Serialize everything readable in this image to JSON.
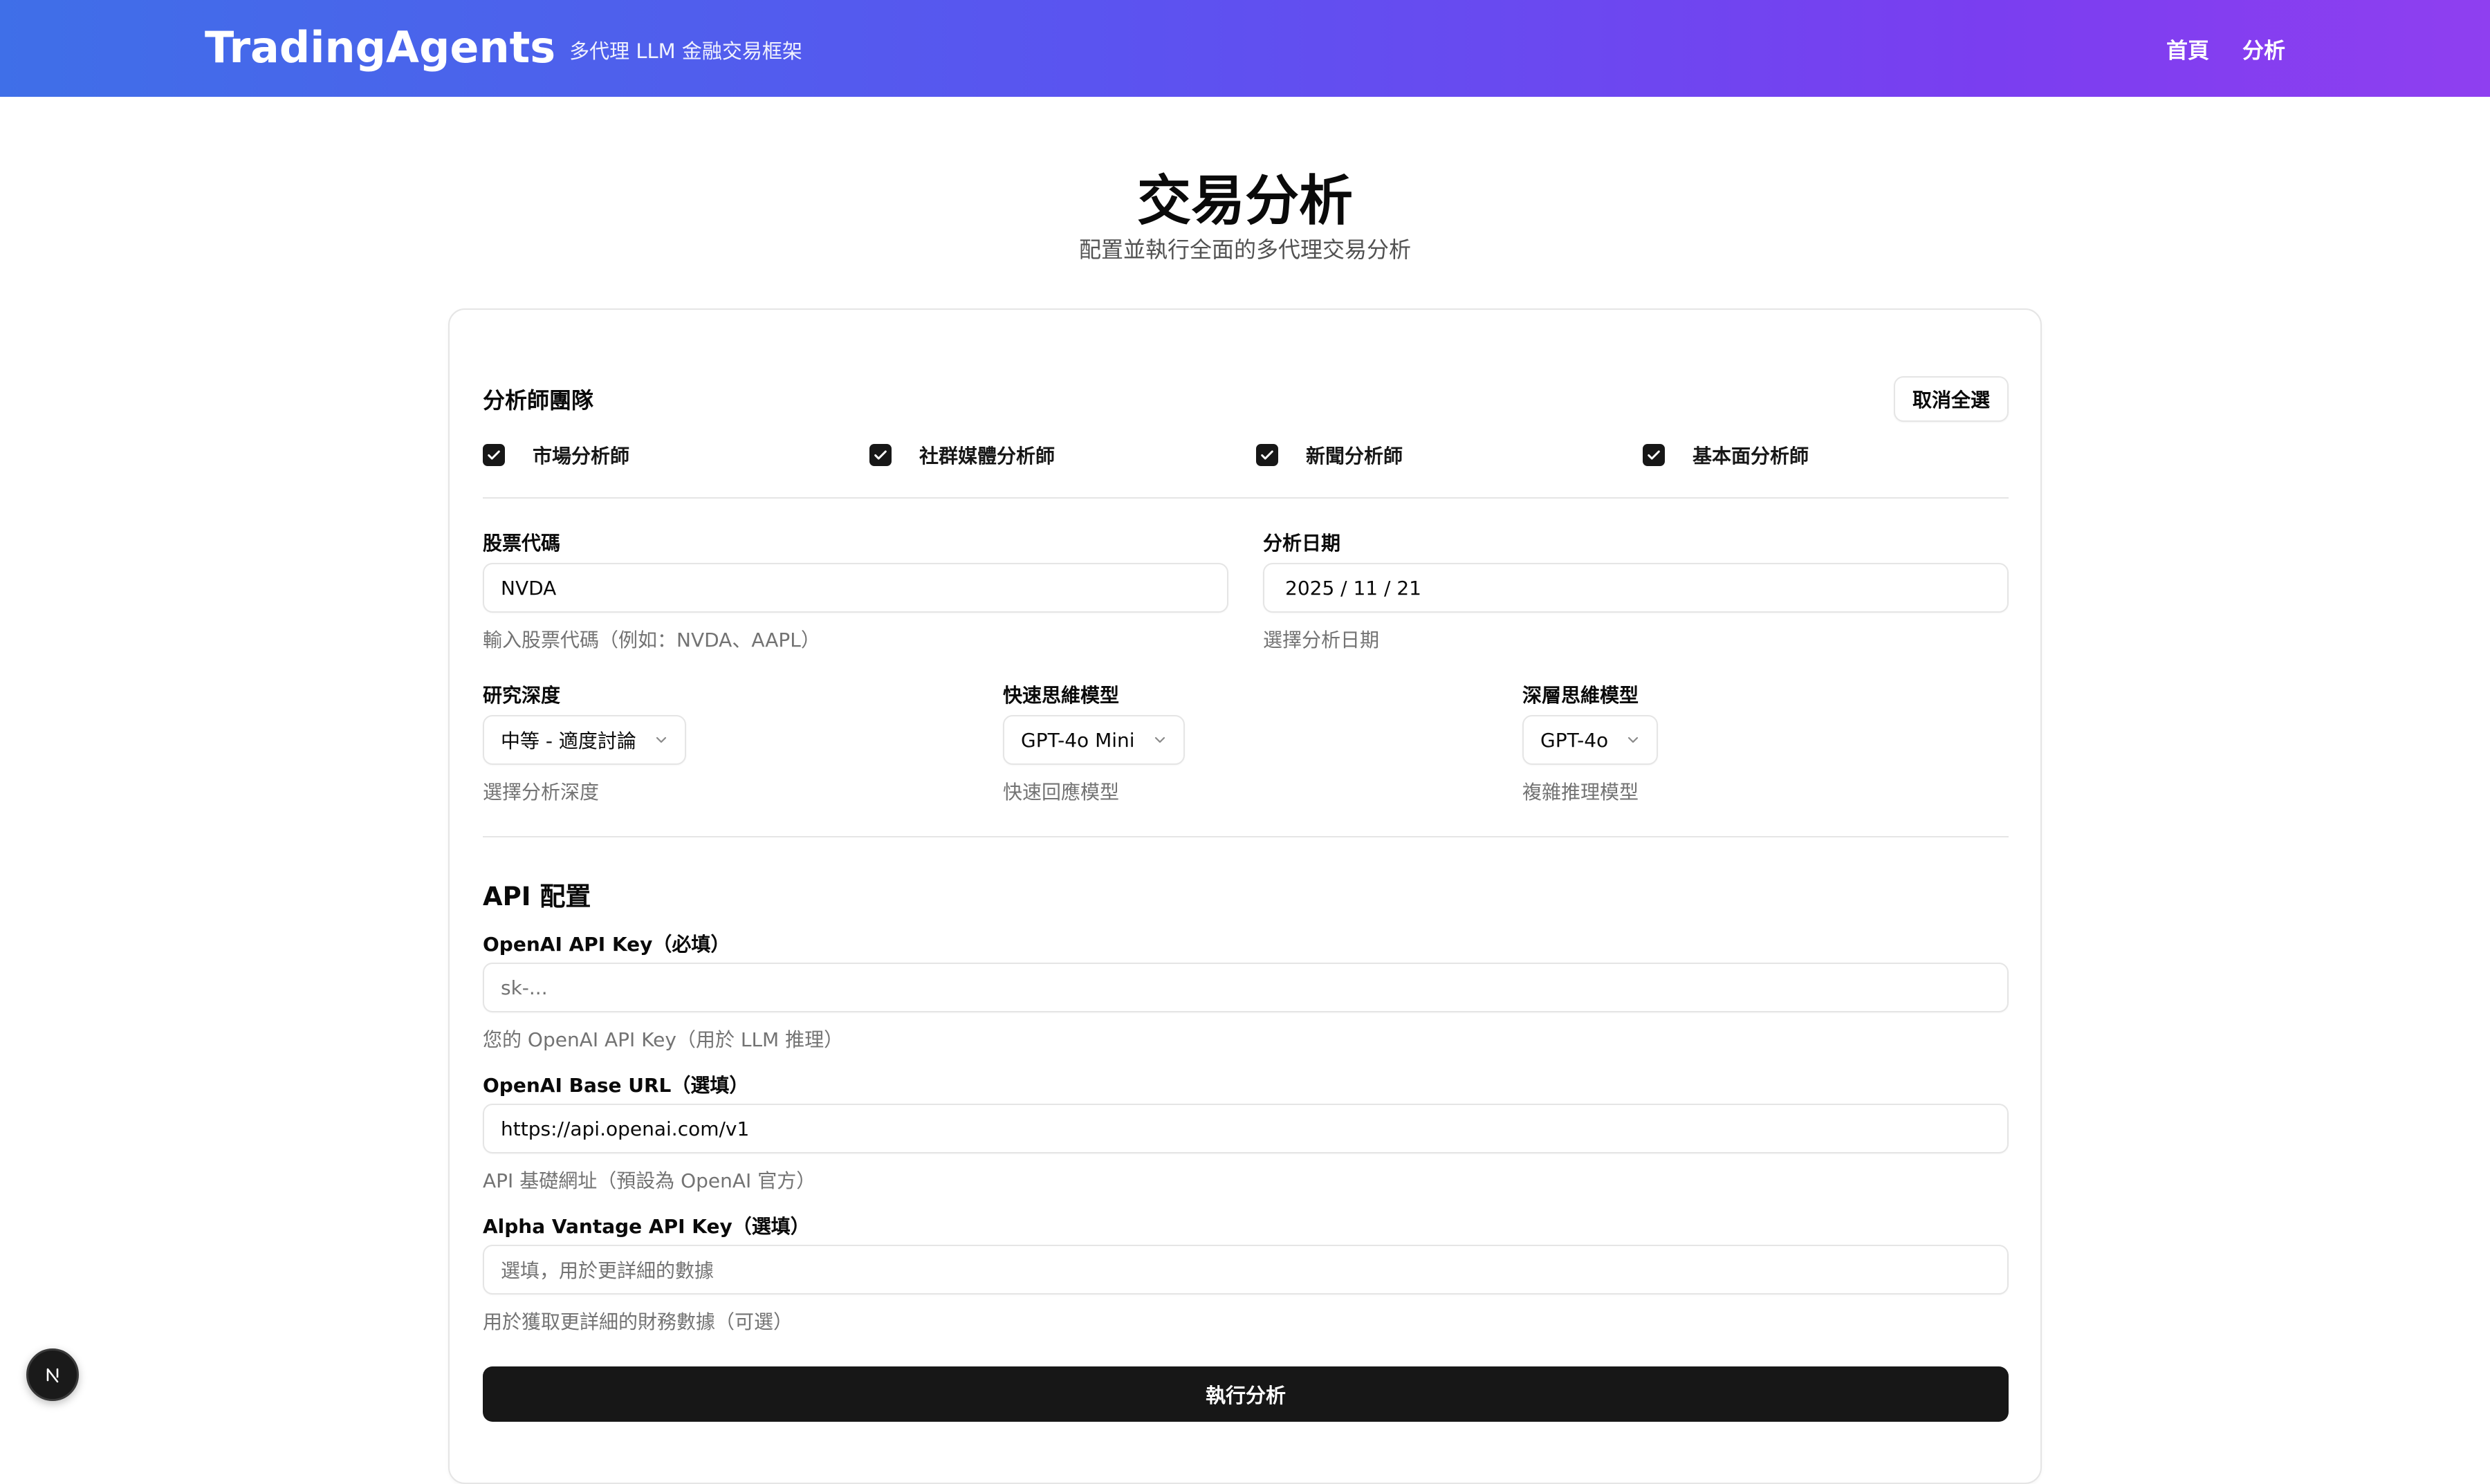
{
  "header": {
    "brand": "TradingAgents",
    "tagline": "多代理 LLM 金融交易框架",
    "nav": {
      "home": "首頁",
      "analysis": "分析"
    }
  },
  "page": {
    "title": "交易分析",
    "subtitle": "配置並執行全面的多代理交易分析"
  },
  "analysts": {
    "title": "分析師團隊",
    "deselect_all": "取消全選",
    "items": [
      {
        "label": "市場分析師",
        "checked": true
      },
      {
        "label": "社群媒體分析師",
        "checked": true
      },
      {
        "label": "新聞分析師",
        "checked": true
      },
      {
        "label": "基本面分析師",
        "checked": true
      }
    ]
  },
  "ticker": {
    "label": "股票代碼",
    "value": "NVDA",
    "hint": "輸入股票代碼（例如：NVDA、AAPL）"
  },
  "date": {
    "label": "分析日期",
    "value": "2025 / 11 / 21",
    "hint": "選擇分析日期"
  },
  "depth": {
    "label": "研究深度",
    "value": "中等 - 適度討論",
    "hint": "選擇分析深度"
  },
  "quick_model": {
    "label": "快速思維模型",
    "value": "GPT-4o Mini",
    "hint": "快速回應模型"
  },
  "deep_model": {
    "label": "深層思維模型",
    "value": "GPT-4o",
    "hint": "複雜推理模型"
  },
  "api": {
    "title": "API 配置",
    "openai_key": {
      "label": "OpenAI API Key（必填）",
      "placeholder": "sk-...",
      "hint": "您的 OpenAI API Key（用於 LLM 推理）"
    },
    "base_url": {
      "label": "OpenAI Base URL（選填）",
      "value": "https://api.openai.com/v1",
      "hint": "API 基礎網址（預設為 OpenAI 官方）"
    },
    "alpha_key": {
      "label": "Alpha Vantage API Key（選填）",
      "placeholder": "選填，用於更詳細的數據",
      "hint": "用於獲取更詳細的財務數據（可選）"
    }
  },
  "submit": "執行分析",
  "badge": "N",
  "colors": {
    "header_gradient_start": "#3f6fe8",
    "header_gradient_end": "#8f3ff0",
    "primary": "#171717"
  }
}
